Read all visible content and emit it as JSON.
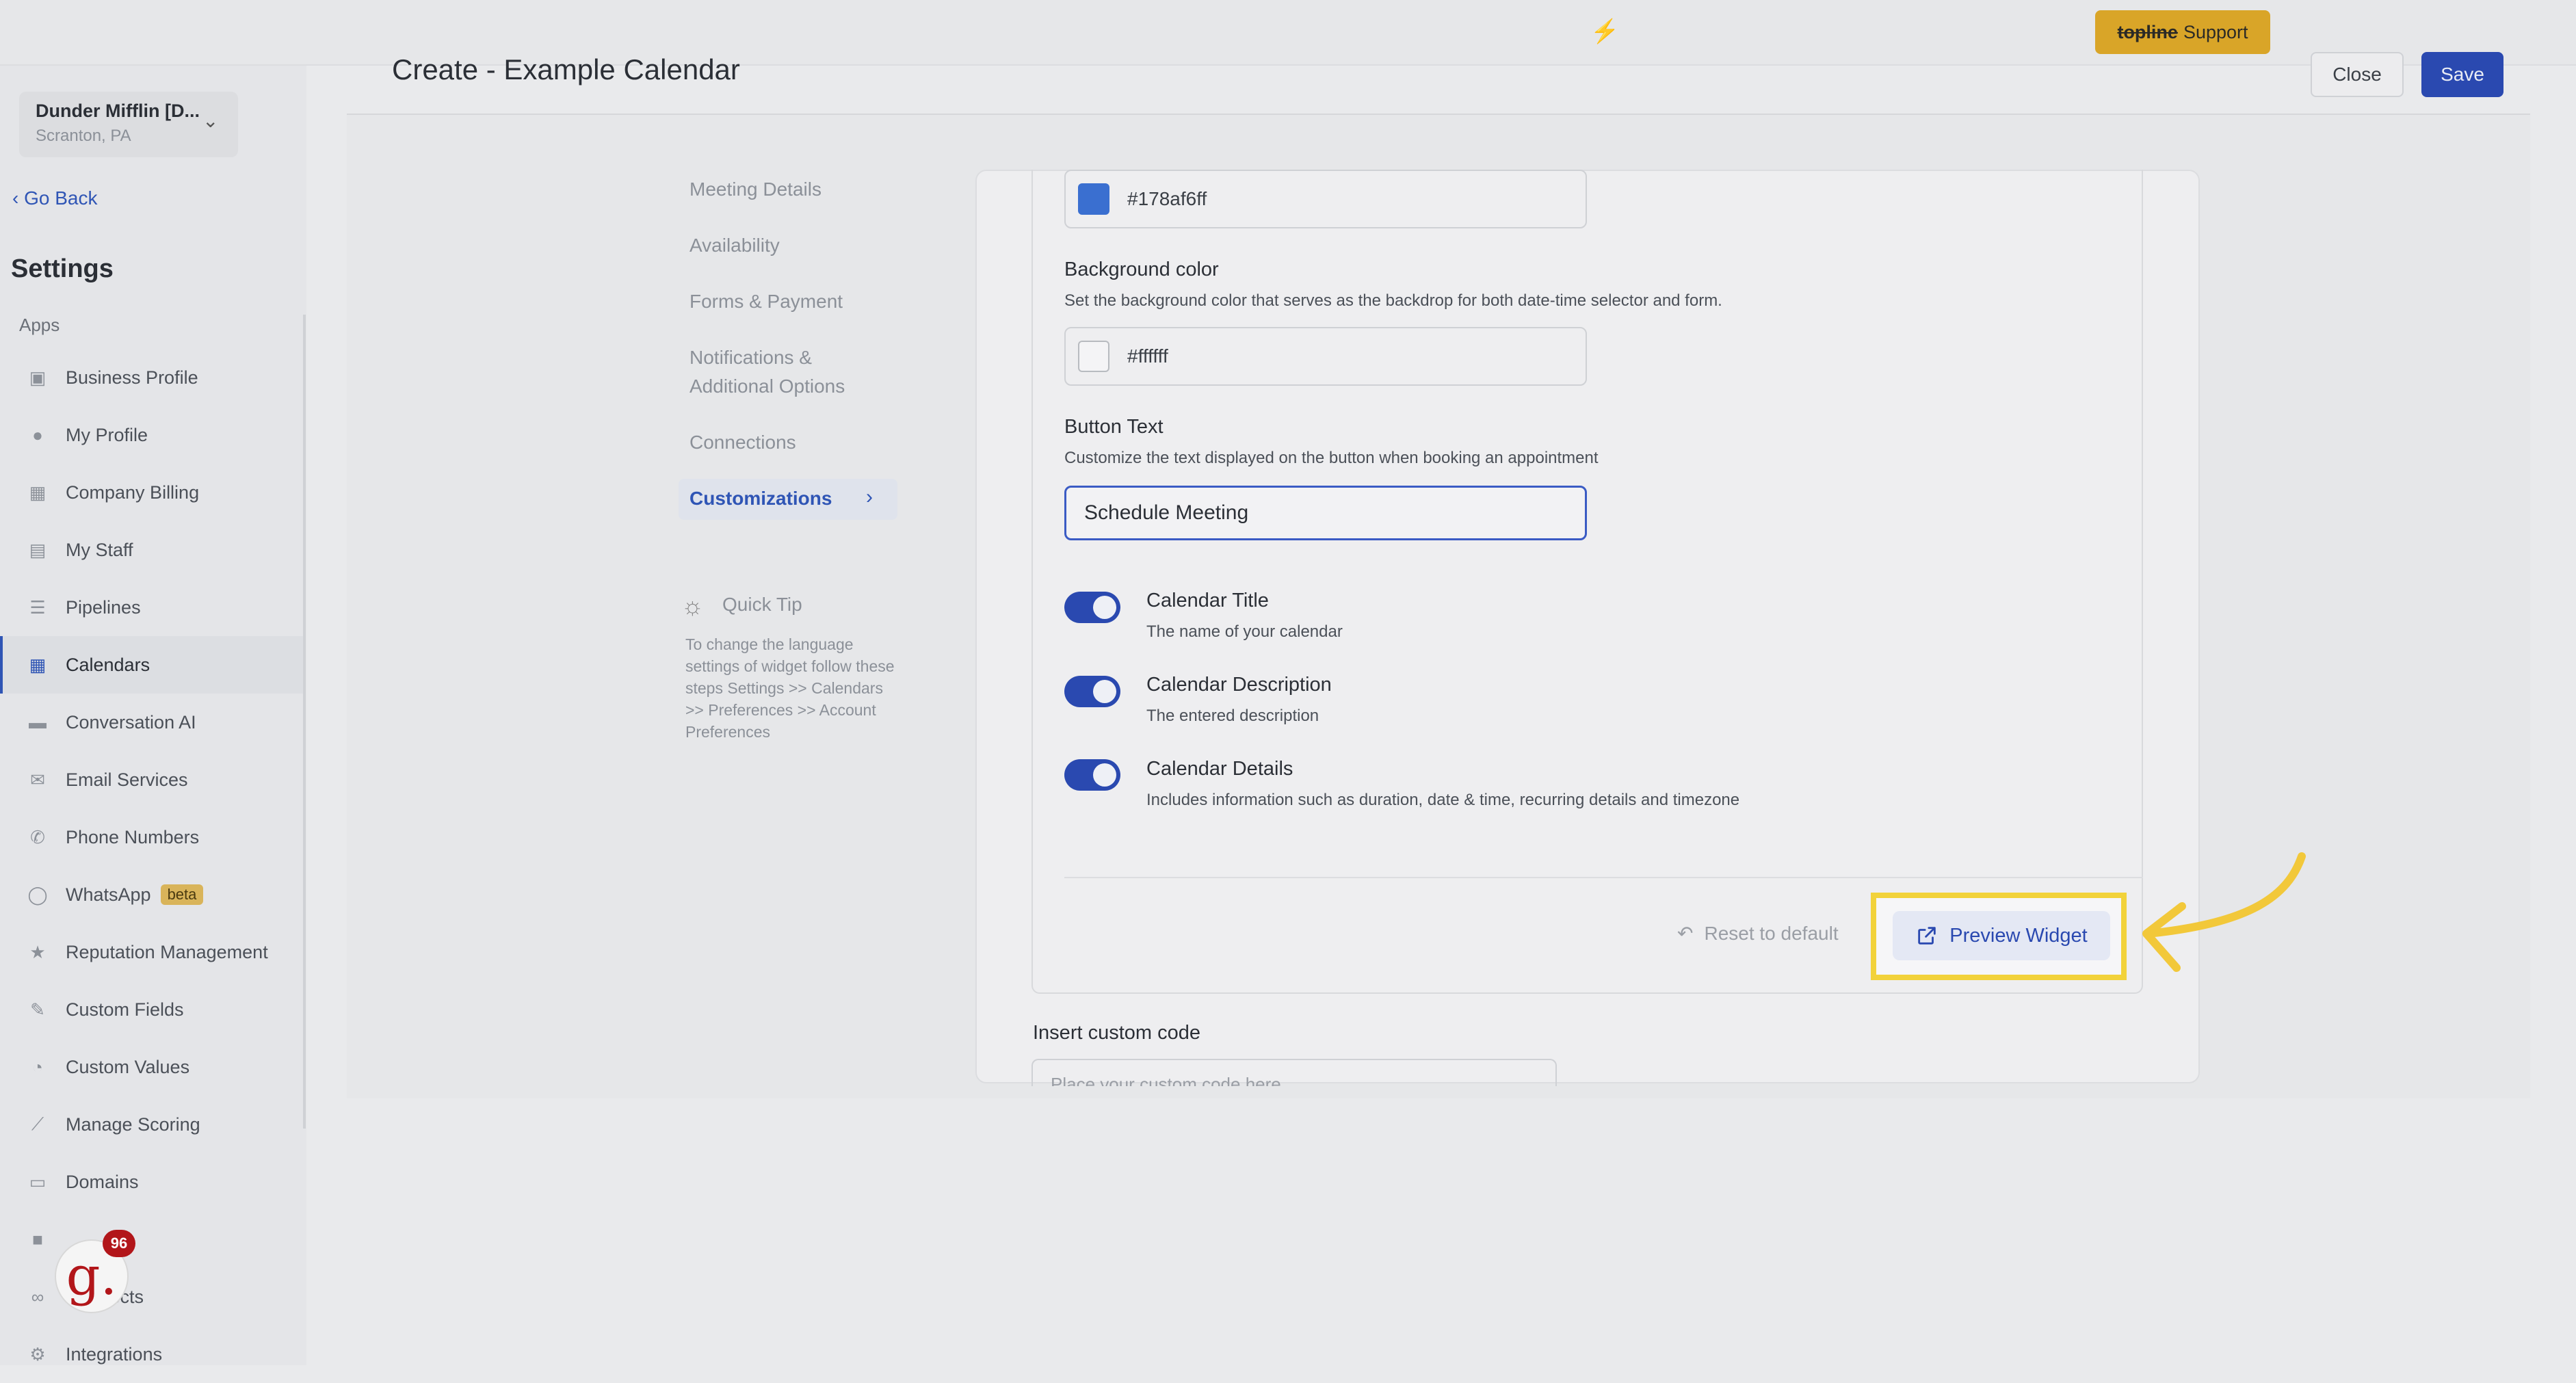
{
  "topbar": {
    "support": {
      "strike": "topline",
      "label": "Support"
    },
    "accent_color": "#d9a528"
  },
  "sidebar": {
    "location": {
      "name": "Dunder Mifflin [D...",
      "city": "Scranton, PA"
    },
    "go_back": "Go Back",
    "settings_title": "Settings",
    "apps_label": "Apps",
    "items": [
      {
        "label": "Business Profile",
        "icon": "briefcase-icon"
      },
      {
        "label": "My Profile",
        "icon": "user-icon"
      },
      {
        "label": "Company Billing",
        "icon": "grid-icon"
      },
      {
        "label": "My Staff",
        "icon": "staff-icon"
      },
      {
        "label": "Pipelines",
        "icon": "filter-icon"
      },
      {
        "label": "Calendars",
        "icon": "calendar-icon",
        "active": true
      },
      {
        "label": "Conversation AI",
        "icon": "chat-icon"
      },
      {
        "label": "Email Services",
        "icon": "mail-icon"
      },
      {
        "label": "Phone Numbers",
        "icon": "phone-icon"
      },
      {
        "label": "WhatsApp",
        "icon": "whatsapp-icon",
        "badge": "beta"
      },
      {
        "label": "Reputation Management",
        "icon": "star-icon"
      },
      {
        "label": "Custom Fields",
        "icon": "edit-icon"
      },
      {
        "label": "Custom Values",
        "icon": "pie-icon"
      },
      {
        "label": "Manage Scoring",
        "icon": "chart-icon"
      },
      {
        "label": "Domains",
        "icon": "domain-icon"
      },
      {
        "label": "",
        "icon": "video-icon"
      },
      {
        "label": "Redirects",
        "icon": "link-icon"
      },
      {
        "label": "Integrations",
        "icon": "integrations-icon"
      }
    ],
    "g_badge": {
      "letter": "g.",
      "count": "96"
    }
  },
  "header": {
    "title": "Create - Example Calendar",
    "close_label": "Close",
    "save_label": "Save"
  },
  "tabs": [
    {
      "label": "Meeting Details"
    },
    {
      "label": "Availability"
    },
    {
      "label": "Forms & Payment"
    },
    {
      "label": "Notifications & Additional Options"
    },
    {
      "label": "Connections"
    },
    {
      "label": "Customizations",
      "active": true
    }
  ],
  "quick_tip": {
    "title": "Quick Tip",
    "text": "To change the language settings of widget follow these steps Settings >> Calendars >> Preferences >> Account Preferences"
  },
  "form": {
    "primary_color": {
      "value": "#178af6ff",
      "swatch": "#3a6fd0"
    },
    "background_color": {
      "label": "Background color",
      "description": "Set the background color that serves as the backdrop for both date-time selector and form.",
      "value": "#ffffff",
      "swatch": "#f4f4f6"
    },
    "button_text": {
      "label": "Button Text",
      "description": "Customize the text displayed on the button when booking an appointment",
      "value": "Schedule Meeting"
    },
    "toggles": [
      {
        "title": "Calendar Title",
        "description": "The name of your calendar",
        "on": true
      },
      {
        "title": "Calendar Description",
        "description": "The entered description",
        "on": true
      },
      {
        "title": "Calendar Details",
        "description": "Includes information such as duration, date & time, recurring details and timezone",
        "on": true
      }
    ],
    "reset_label": "Reset to default",
    "preview_label": "Preview Widget",
    "custom_code": {
      "label": "Insert custom code",
      "placeholder": "Place your custom code here"
    },
    "highlight_color": "#f2d23a"
  }
}
